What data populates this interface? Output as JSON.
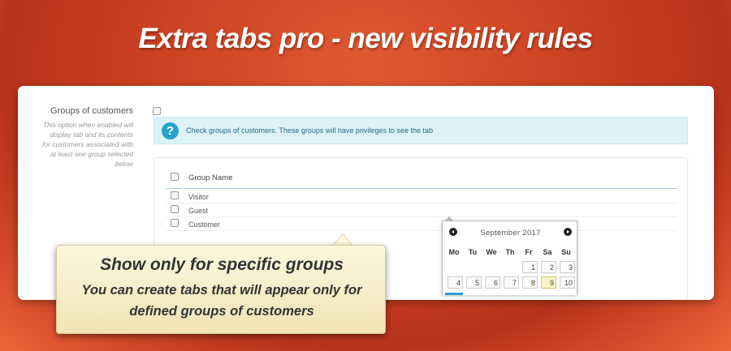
{
  "banner": {
    "headline": "Extra tabs pro - new visibility rules"
  },
  "groups_section": {
    "label": "Groups of customers",
    "help": "This option when enabled will display tab and its contents for customers associated with at least one group selected below",
    "alert_text": "Check groups of customers. These groups will have privileges to see the tab",
    "alert_icon": "question-icon",
    "table_header": "Group Name",
    "rows": [
      {
        "label": "Visitor"
      },
      {
        "label": "Guest"
      },
      {
        "label": "Customer"
      }
    ]
  },
  "calendar": {
    "month_label": "September 2017",
    "weekdays": [
      "Mo",
      "Tu",
      "We",
      "Th",
      "Fr",
      "Sa",
      "Su"
    ],
    "week1": [
      "1",
      "2",
      "3"
    ],
    "week2": [
      "4",
      "5",
      "6",
      "7",
      "8",
      "9",
      "10"
    ],
    "highlighted_day": "9"
  },
  "callout": {
    "title": "Show only for specific groups",
    "text": "You can create tabs that will appear only for defined groups of customers"
  },
  "colors": {
    "background": "#c93f22",
    "info_accent": "#25a3c9",
    "callout_bg": "#f6ecc6"
  }
}
